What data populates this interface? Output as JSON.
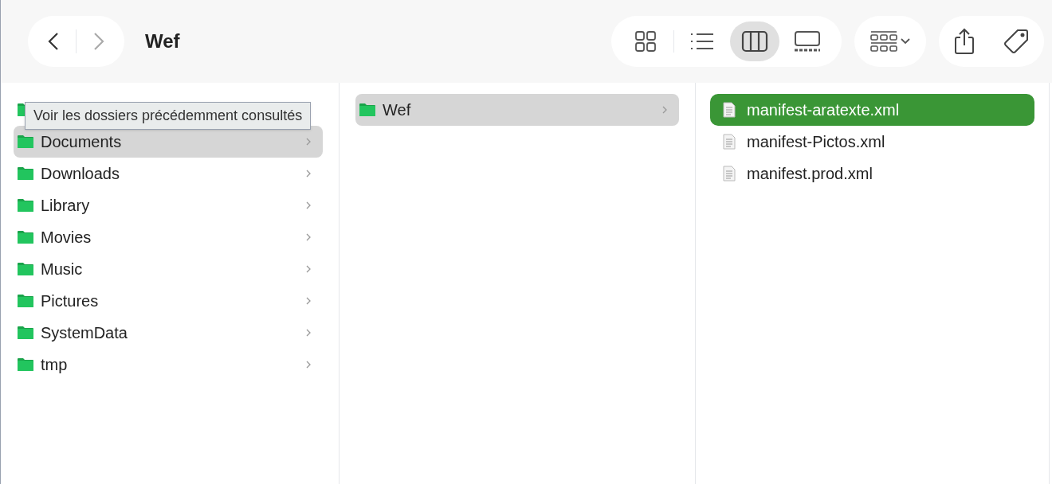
{
  "window": {
    "title": "Wef"
  },
  "view_modes": [
    {
      "kind": "icons",
      "selected": false
    },
    {
      "kind": "list",
      "selected": false
    },
    {
      "kind": "columns",
      "selected": true
    },
    {
      "kind": "gallery",
      "selected": false
    }
  ],
  "tooltip": "Voir les dossiers précédemment consultés",
  "columns": [
    {
      "items": [
        {
          "name": "Documents",
          "selected": true
        },
        {
          "name": "Downloads",
          "selected": false
        },
        {
          "name": "Library",
          "selected": false
        },
        {
          "name": "Movies",
          "selected": false
        },
        {
          "name": "Music",
          "selected": false
        },
        {
          "name": "Pictures",
          "selected": false
        },
        {
          "name": "SystemData",
          "selected": false
        },
        {
          "name": "tmp",
          "selected": false
        }
      ]
    },
    {
      "items": [
        {
          "name": "Wef",
          "selected": true
        }
      ]
    }
  ],
  "files": [
    {
      "name": "manifest-aratexte.xml",
      "selected": true
    },
    {
      "name": "manifest-Pictos.xml",
      "selected": false
    },
    {
      "name": "manifest.prod.xml",
      "selected": false
    }
  ]
}
